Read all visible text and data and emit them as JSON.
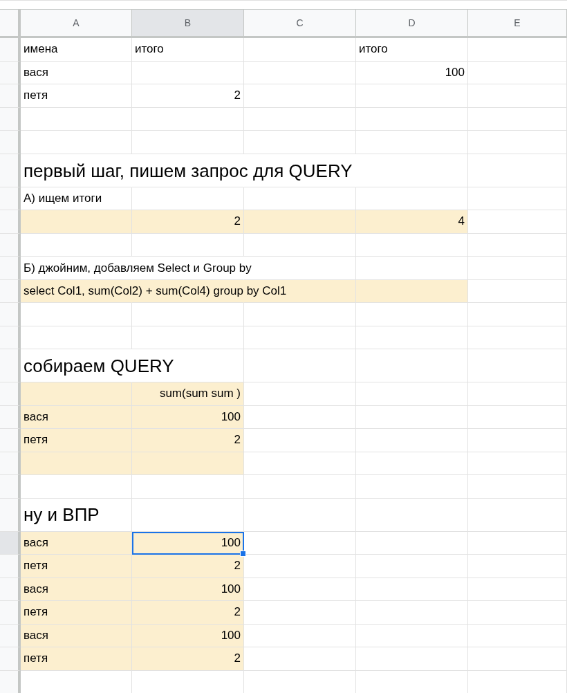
{
  "columns": [
    {
      "label": "A",
      "selected": false
    },
    {
      "label": "B",
      "selected": true
    },
    {
      "label": "C",
      "selected": false
    },
    {
      "label": "D",
      "selected": false
    },
    {
      "label": "E",
      "selected": false
    }
  ],
  "rows": [
    {
      "kind": "normal",
      "cells": [
        {
          "text": "имена",
          "kind": "text",
          "filled": false,
          "selected": false
        },
        {
          "text": "итого",
          "kind": "text",
          "filled": false,
          "selected": false
        },
        {
          "filled": false,
          "selected": false
        },
        {
          "text": "итого",
          "kind": "text",
          "filled": false,
          "selected": false
        },
        {
          "filled": false,
          "selected": false
        }
      ]
    },
    {
      "kind": "normal",
      "cells": [
        {
          "text": "вася",
          "kind": "text",
          "filled": false,
          "selected": false
        },
        {
          "filled": false,
          "selected": false
        },
        {
          "filled": false,
          "selected": false
        },
        {
          "text": "100",
          "kind": "number",
          "filled": false,
          "selected": false
        },
        {
          "filled": false,
          "selected": false
        }
      ]
    },
    {
      "kind": "normal",
      "cells": [
        {
          "text": "петя",
          "kind": "text",
          "filled": false,
          "selected": false
        },
        {
          "text": "2",
          "kind": "number",
          "filled": false,
          "selected": false
        },
        {
          "filled": false,
          "selected": false
        },
        {
          "filled": false,
          "selected": false
        },
        {
          "filled": false,
          "selected": false
        }
      ]
    },
    {
      "kind": "normal",
      "cells": [
        {
          "filled": false,
          "selected": false
        },
        {
          "filled": false,
          "selected": false
        },
        {
          "filled": false,
          "selected": false
        },
        {
          "filled": false,
          "selected": false
        },
        {
          "filled": false,
          "selected": false
        }
      ]
    },
    {
      "kind": "normal",
      "cells": [
        {
          "filled": false,
          "selected": false
        },
        {
          "filled": false,
          "selected": false
        },
        {
          "filled": false,
          "selected": false
        },
        {
          "filled": false,
          "selected": false
        },
        {
          "filled": false,
          "selected": false
        }
      ]
    },
    {
      "kind": "heading",
      "cells": [
        {
          "text": "первый шаг, пишем запрос для QUERY",
          "kind": "text",
          "filled": false,
          "selected": false
        },
        {
          "filled": false,
          "selected": false
        },
        {
          "filled": false,
          "selected": false
        },
        {
          "filled": false,
          "selected": false
        },
        {
          "filled": false,
          "selected": false
        }
      ]
    },
    {
      "kind": "normal",
      "cells": [
        {
          "text": "А) ищем итоги",
          "kind": "text",
          "filled": false,
          "selected": false
        },
        {
          "filled": false,
          "selected": false
        },
        {
          "filled": false,
          "selected": false
        },
        {
          "filled": false,
          "selected": false
        },
        {
          "filled": false,
          "selected": false
        }
      ]
    },
    {
      "kind": "normal",
      "cells": [
        {
          "filled": true,
          "selected": false
        },
        {
          "text": "2",
          "kind": "number",
          "filled": true,
          "selected": false
        },
        {
          "filled": true,
          "selected": false
        },
        {
          "text": "4",
          "kind": "number",
          "filled": true,
          "selected": false
        },
        {
          "filled": false,
          "selected": false
        }
      ]
    },
    {
      "kind": "normal",
      "cells": [
        {
          "filled": false,
          "selected": false
        },
        {
          "filled": false,
          "selected": false
        },
        {
          "filled": false,
          "selected": false
        },
        {
          "filled": false,
          "selected": false
        },
        {
          "filled": false,
          "selected": false
        }
      ]
    },
    {
      "kind": "normal",
      "cells": [
        {
          "text": "Б) джойним, добавляем Select и Group by",
          "kind": "text",
          "filled": false,
          "selected": false
        },
        {
          "filled": false,
          "selected": false
        },
        {
          "filled": false,
          "selected": false
        },
        {
          "filled": false,
          "selected": false
        },
        {
          "filled": false,
          "selected": false
        }
      ]
    },
    {
      "kind": "normal",
      "cells": [
        {
          "text": "select Col1, sum(Col2) + sum(Col4) group by Col1",
          "kind": "text",
          "filled": true,
          "selected": false
        },
        {
          "filled": true,
          "selected": false
        },
        {
          "filled": true,
          "selected": false
        },
        {
          "filled": true,
          "selected": false
        },
        {
          "filled": false,
          "selected": false
        }
      ]
    },
    {
      "kind": "normal",
      "cells": [
        {
          "filled": false,
          "selected": false
        },
        {
          "filled": false,
          "selected": false
        },
        {
          "filled": false,
          "selected": false
        },
        {
          "filled": false,
          "selected": false
        },
        {
          "filled": false,
          "selected": false
        }
      ]
    },
    {
      "kind": "normal",
      "cells": [
        {
          "filled": false,
          "selected": false
        },
        {
          "filled": false,
          "selected": false
        },
        {
          "filled": false,
          "selected": false
        },
        {
          "filled": false,
          "selected": false
        },
        {
          "filled": false,
          "selected": false
        }
      ]
    },
    {
      "kind": "heading",
      "cells": [
        {
          "text": "собираем QUERY",
          "kind": "text",
          "filled": false,
          "selected": false
        },
        {
          "filled": false,
          "selected": false
        },
        {
          "filled": false,
          "selected": false
        },
        {
          "filled": false,
          "selected": false
        },
        {
          "filled": false,
          "selected": false
        }
      ]
    },
    {
      "kind": "normal",
      "cells": [
        {
          "filled": true,
          "selected": false
        },
        {
          "text": "sum(sum sum )",
          "kind": "number",
          "filled": true,
          "selected": false
        },
        {
          "filled": false,
          "selected": false
        },
        {
          "filled": false,
          "selected": false
        },
        {
          "filled": false,
          "selected": false
        }
      ]
    },
    {
      "kind": "normal",
      "cells": [
        {
          "text": "вася",
          "kind": "text",
          "filled": true,
          "selected": false
        },
        {
          "text": "100",
          "kind": "number",
          "filled": true,
          "selected": false
        },
        {
          "filled": false,
          "selected": false
        },
        {
          "filled": false,
          "selected": false
        },
        {
          "filled": false,
          "selected": false
        }
      ]
    },
    {
      "kind": "normal",
      "cells": [
        {
          "text": "петя",
          "kind": "text",
          "filled": true,
          "selected": false
        },
        {
          "text": "2",
          "kind": "number",
          "filled": true,
          "selected": false
        },
        {
          "filled": false,
          "selected": false
        },
        {
          "filled": false,
          "selected": false
        },
        {
          "filled": false,
          "selected": false
        }
      ]
    },
    {
      "kind": "normal",
      "cells": [
        {
          "filled": true,
          "selected": false
        },
        {
          "filled": true,
          "selected": false
        },
        {
          "filled": false,
          "selected": false
        },
        {
          "filled": false,
          "selected": false
        },
        {
          "filled": false,
          "selected": false
        }
      ]
    },
    {
      "kind": "normal",
      "cells": [
        {
          "filled": false,
          "selected": false
        },
        {
          "filled": false,
          "selected": false
        },
        {
          "filled": false,
          "selected": false
        },
        {
          "filled": false,
          "selected": false
        },
        {
          "filled": false,
          "selected": false
        }
      ]
    },
    {
      "kind": "heading",
      "cells": [
        {
          "text": "ну и ВПР",
          "kind": "text",
          "filled": false,
          "selected": false
        },
        {
          "filled": false,
          "selected": false
        },
        {
          "filled": false,
          "selected": false
        },
        {
          "filled": false,
          "selected": false
        },
        {
          "filled": false,
          "selected": false
        }
      ]
    },
    {
      "kind": "normal",
      "cells": [
        {
          "text": "вася",
          "kind": "text",
          "filled": true,
          "selected": false
        },
        {
          "text": "100",
          "kind": "number",
          "filled": true,
          "selected": true
        },
        {
          "filled": false,
          "selected": false
        },
        {
          "filled": false,
          "selected": false
        },
        {
          "filled": false,
          "selected": false
        }
      ]
    },
    {
      "kind": "normal",
      "cells": [
        {
          "text": "петя",
          "kind": "text",
          "filled": true,
          "selected": false
        },
        {
          "text": "2",
          "kind": "number",
          "filled": true,
          "selected": false
        },
        {
          "filled": false,
          "selected": false
        },
        {
          "filled": false,
          "selected": false
        },
        {
          "filled": false,
          "selected": false
        }
      ]
    },
    {
      "kind": "normal",
      "cells": [
        {
          "text": "вася",
          "kind": "text",
          "filled": true,
          "selected": false
        },
        {
          "text": "100",
          "kind": "number",
          "filled": true,
          "selected": false
        },
        {
          "filled": false,
          "selected": false
        },
        {
          "filled": false,
          "selected": false
        },
        {
          "filled": false,
          "selected": false
        }
      ]
    },
    {
      "kind": "normal",
      "cells": [
        {
          "text": "петя",
          "kind": "text",
          "filled": true,
          "selected": false
        },
        {
          "text": "2",
          "kind": "number",
          "filled": true,
          "selected": false
        },
        {
          "filled": false,
          "selected": false
        },
        {
          "filled": false,
          "selected": false
        },
        {
          "filled": false,
          "selected": false
        }
      ]
    },
    {
      "kind": "normal",
      "cells": [
        {
          "text": "вася",
          "kind": "text",
          "filled": true,
          "selected": false
        },
        {
          "text": "100",
          "kind": "number",
          "filled": true,
          "selected": false
        },
        {
          "filled": false,
          "selected": false
        },
        {
          "filled": false,
          "selected": false
        },
        {
          "filled": false,
          "selected": false
        }
      ]
    },
    {
      "kind": "normal",
      "cells": [
        {
          "text": "петя",
          "kind": "text",
          "filled": true,
          "selected": false
        },
        {
          "text": "2",
          "kind": "number",
          "filled": true,
          "selected": false
        },
        {
          "filled": false,
          "selected": false
        },
        {
          "filled": false,
          "selected": false
        },
        {
          "filled": false,
          "selected": false
        }
      ]
    },
    {
      "kind": "normal",
      "cells": [
        {
          "filled": false,
          "selected": false
        },
        {
          "filled": false,
          "selected": false
        },
        {
          "filled": false,
          "selected": false
        },
        {
          "filled": false,
          "selected": false
        },
        {
          "filled": false,
          "selected": false
        }
      ]
    }
  ]
}
